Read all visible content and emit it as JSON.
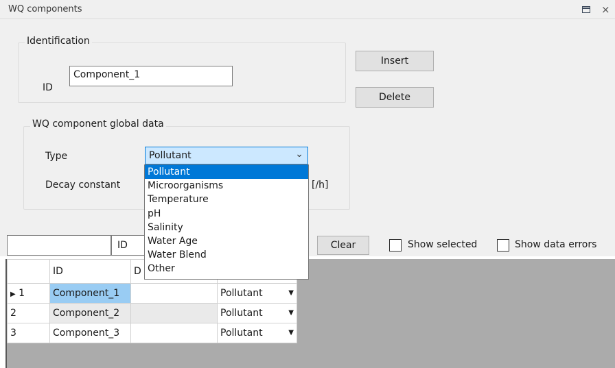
{
  "window": {
    "title": "WQ components",
    "restore_icon": "restore-icon",
    "close_glyph": "×"
  },
  "identification": {
    "group_label": "Identification",
    "id_label": "ID",
    "id_value": "Component_1"
  },
  "actions": {
    "insert_label": "Insert",
    "delete_label": "Delete"
  },
  "global_data": {
    "group_label": "WQ component global data",
    "type_label": "Type",
    "type_value": "Pollutant",
    "decay_label": "Decay constant",
    "decay_unit": "[/h]",
    "type_options": [
      "Pollutant",
      "Microorganisms",
      "Temperature",
      "pH",
      "Salinity",
      "Water Age",
      "Water Blend",
      "Other"
    ],
    "selected_option": "Pollutant"
  },
  "toolbar": {
    "filter_value": "",
    "filter_field": "ID",
    "clear_label": "Clear",
    "show_selected_label": "Show selected",
    "show_errors_label": "Show data errors"
  },
  "grid": {
    "headers": [
      "",
      "ID",
      "D",
      ""
    ],
    "rows": [
      {
        "num": "1",
        "marker": "▶",
        "id": "Component_1",
        "d": "",
        "type": "Pollutant"
      },
      {
        "num": "2",
        "marker": "",
        "id": "Component_2",
        "d": "",
        "type": "Pollutant"
      },
      {
        "num": "3",
        "marker": "",
        "id": "Component_3",
        "d": "",
        "type": "Pollutant"
      }
    ]
  },
  "colors": {
    "selection": "#0078d7",
    "cell_selection": "#99ccf3",
    "panel": "#f0f0f0"
  }
}
